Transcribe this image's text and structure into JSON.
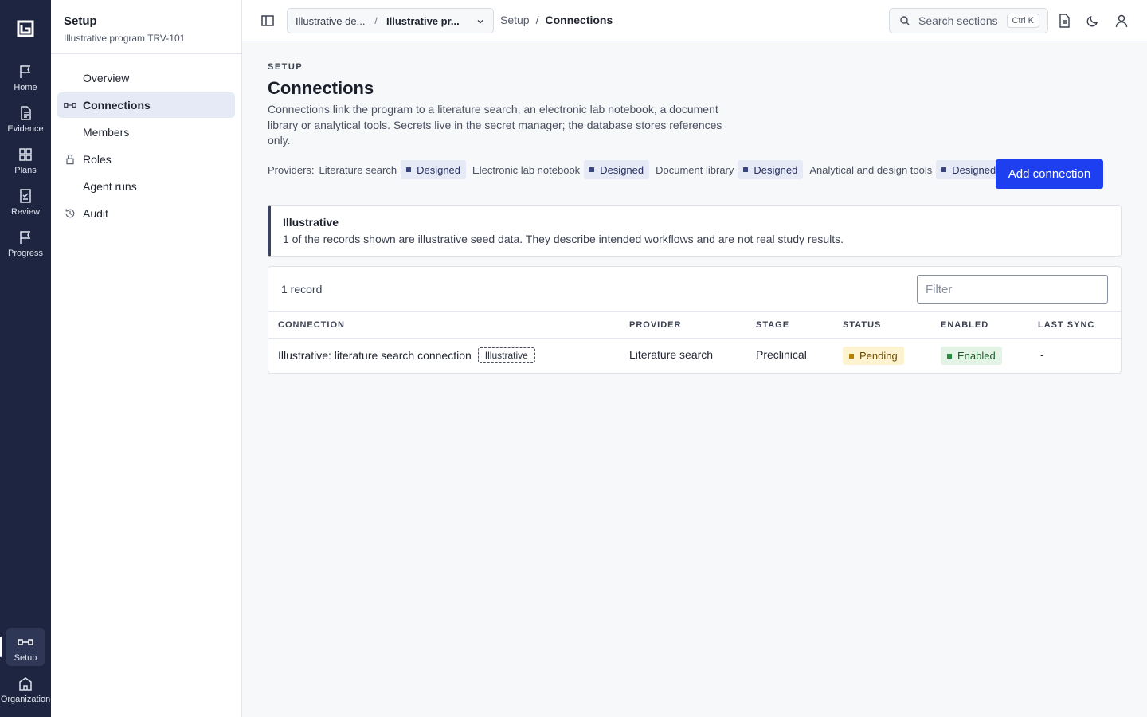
{
  "rail": {
    "items": [
      {
        "label": "Home",
        "icon": "flag-icon"
      },
      {
        "label": "Evidence",
        "icon": "document-icon"
      },
      {
        "label": "Plans",
        "icon": "grid-icon"
      },
      {
        "label": "Review",
        "icon": "checklist-icon"
      },
      {
        "label": "Progress",
        "icon": "flag-icon"
      }
    ],
    "bottom": [
      {
        "label": "Setup",
        "icon": "connection-icon",
        "active": true
      },
      {
        "label": "Organization",
        "icon": "building-icon"
      }
    ]
  },
  "sidebar": {
    "title": "Setup",
    "subtitle": "Illustrative program TRV-101",
    "items": [
      {
        "label": "Overview",
        "icon": ""
      },
      {
        "label": "Connections",
        "icon": "connection-icon",
        "active": true
      },
      {
        "label": "Members",
        "icon": ""
      },
      {
        "label": "Roles",
        "icon": "lock-icon"
      },
      {
        "label": "Agent runs",
        "icon": ""
      },
      {
        "label": "Audit",
        "icon": "history-icon"
      }
    ]
  },
  "topbar": {
    "context_a": "Illustrative de...",
    "context_sep": "/",
    "context_b": "Illustrative pr...",
    "breadcrumb": [
      "Setup",
      "/",
      "Connections"
    ],
    "search_placeholder": "Search sections",
    "search_shortcut": "Ctrl K"
  },
  "page": {
    "eyebrow": "SETUP",
    "title": "Connections",
    "description": "Connections link the program to a literature search, an electronic lab notebook, a document library or analytical tools. Secrets live in the secret manager; the database stores references only.",
    "providers_label": "Providers:",
    "providers": [
      {
        "name": "Literature search",
        "status": "Designed"
      },
      {
        "name": "Electronic lab notebook",
        "status": "Designed"
      },
      {
        "name": "Document library",
        "status": "Designed"
      },
      {
        "name": "Analytical and design tools",
        "status": "Designed"
      }
    ],
    "add_button": "Add connection"
  },
  "notice": {
    "title": "Illustrative",
    "text": "1 of the records shown are illustrative seed data. They describe intended workflows and are not real study results."
  },
  "table": {
    "count": "1 record",
    "filter_placeholder": "Filter",
    "columns": [
      "CONNECTION",
      "PROVIDER",
      "STAGE",
      "STATUS",
      "ENABLED",
      "LAST SYNC"
    ],
    "rows": [
      {
        "connection": "Illustrative: literature search connection",
        "tag": "Illustrative",
        "provider": "Literature search",
        "stage": "Preclinical",
        "status": "Pending",
        "enabled": "Enabled",
        "last_sync": "-"
      }
    ]
  },
  "colors": {
    "accent": "#1e3ff0",
    "rail": "#1d2540",
    "pending": "#fdf3d0",
    "enabled": "#e3f3e6"
  }
}
